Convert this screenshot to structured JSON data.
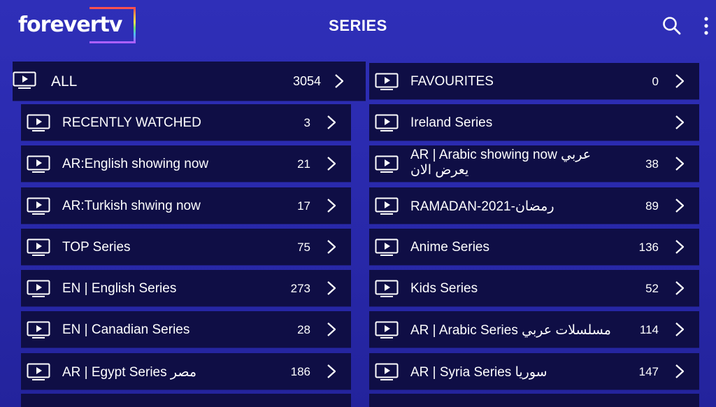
{
  "header": {
    "logo_text": "forevertv",
    "title": "SERIES",
    "search_icon": "search-icon",
    "menu_icon": "more-vertical-icon"
  },
  "colors": {
    "background": "#2b2bb0",
    "row_background": "#0f0e45",
    "text": "#ffffff"
  },
  "all_row": {
    "label": "ALL",
    "count": "3054"
  },
  "left_rows": [
    {
      "label": "RECENTLY WATCHED",
      "count": "3"
    },
    {
      "label": "AR:English showing now",
      "count": "21"
    },
    {
      "label": "AR:Turkish shwing now",
      "count": "17"
    },
    {
      "label": "TOP Series",
      "count": "75"
    },
    {
      "label": "EN | English Series",
      "count": "273"
    },
    {
      "label": "EN | Canadian Series",
      "count": "28"
    },
    {
      "label": "AR | Egypt Series مصر",
      "count": "186"
    }
  ],
  "right_rows": [
    {
      "label": "FAVOURITES",
      "count": "0"
    },
    {
      "label": "Ireland Series",
      "count": ""
    },
    {
      "label": "AR | Arabic showing now عربي يعرض الان",
      "count": "38"
    },
    {
      "label": "RAMADAN-2021-رمضان",
      "count": "89"
    },
    {
      "label": "Anime Series",
      "count": "136"
    },
    {
      "label": "Kids Series",
      "count": "52"
    },
    {
      "label": "AR | Arabic Series مسلسلات عربي",
      "count": "114"
    },
    {
      "label": "AR | Syria Series سوريا",
      "count": "147"
    }
  ]
}
